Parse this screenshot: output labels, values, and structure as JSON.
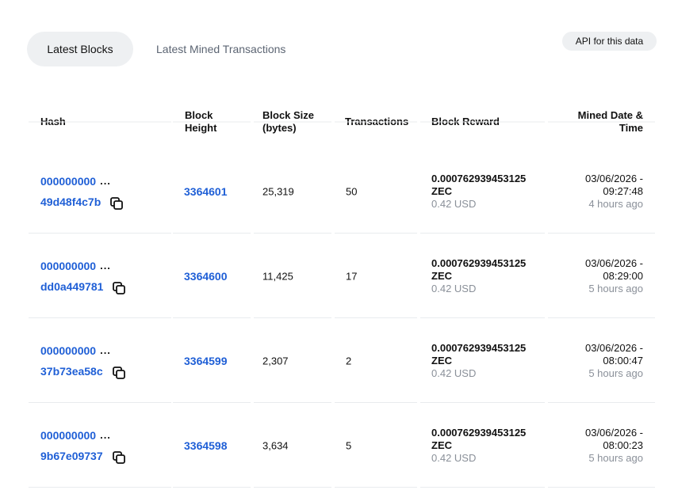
{
  "tabs": {
    "latest_blocks": "Latest Blocks",
    "latest_mined_transactions": "Latest Mined Transactions"
  },
  "api_button": "API for this data",
  "columns": {
    "hash": "Hash",
    "block_height_1": "Block",
    "block_height_2": "Height",
    "block_size_1": "Block Size",
    "block_size_2": "(bytes)",
    "transactions": "Transactions",
    "block_reward": "Block Reward",
    "mined_1": "Mined Date &",
    "mined_2": "Time"
  },
  "rows": [
    {
      "hash_prefix": "000000000",
      "ellipsis": "...",
      "hash_suffix": "49d48f4c7b",
      "height": "3364601",
      "size": "25,319",
      "transactions": "50",
      "reward_amount": "0.000762939453125",
      "reward_unit": "ZEC",
      "reward_usd": "0.42 USD",
      "date": "03/06/2026 -",
      "time": "09:27:48",
      "ago": "4 hours ago"
    },
    {
      "hash_prefix": "000000000",
      "ellipsis": "...",
      "hash_suffix": "dd0a449781",
      "height": "3364600",
      "size": "11,425",
      "transactions": "17",
      "reward_amount": "0.000762939453125",
      "reward_unit": "ZEC",
      "reward_usd": "0.42 USD",
      "date": "03/06/2026 -",
      "time": "08:29:00",
      "ago": "5 hours ago"
    },
    {
      "hash_prefix": "000000000",
      "ellipsis": "...",
      "hash_suffix": "37b73ea58c",
      "height": "3364599",
      "size": "2,307",
      "transactions": "2",
      "reward_amount": "0.000762939453125",
      "reward_unit": "ZEC",
      "reward_usd": "0.42 USD",
      "date": "03/06/2026 -",
      "time": "08:00:47",
      "ago": "5 hours ago"
    },
    {
      "hash_prefix": "000000000",
      "ellipsis": "...",
      "hash_suffix": "9b67e09737",
      "height": "3364598",
      "size": "3,634",
      "transactions": "5",
      "reward_amount": "0.000762939453125",
      "reward_unit": "ZEC",
      "reward_usd": "0.42 USD",
      "date": "03/06/2026 -",
      "time": "08:00:23",
      "ago": "5 hours ago"
    }
  ],
  "icons": {
    "copy": "copy-icon"
  },
  "colors": {
    "link": "#1f5fd6",
    "muted": "#8a9099",
    "tab_bg": "#eef0f2"
  }
}
